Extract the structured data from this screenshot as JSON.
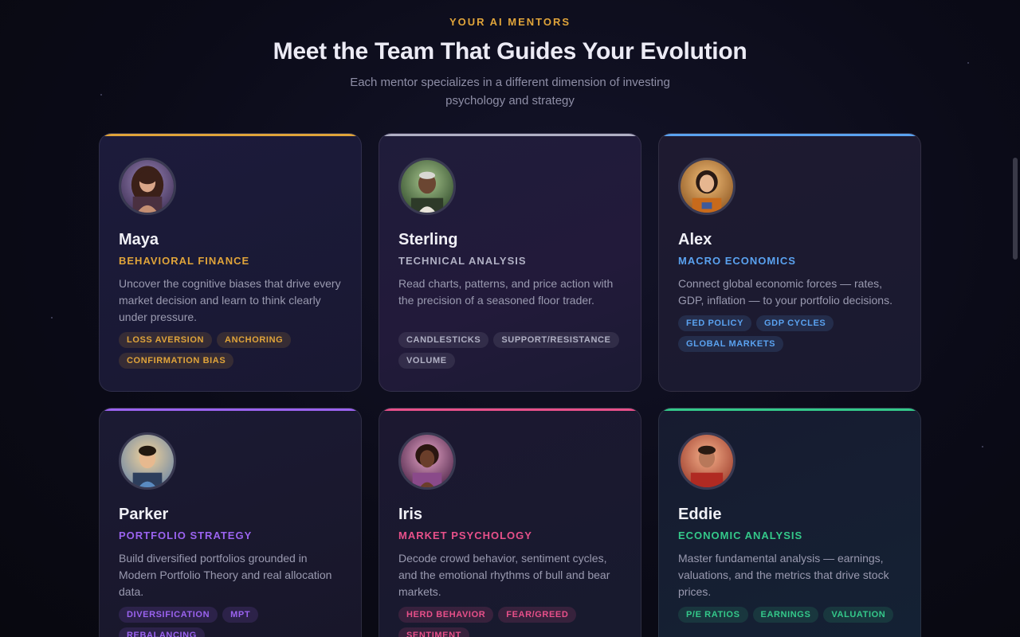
{
  "header": {
    "eyebrow": "YOUR AI MENTORS",
    "title": "Meet the Team That Guides Your Evolution",
    "subtitle": "Each mentor specializes in a different dimension of investing psychology and strategy"
  },
  "mentors": [
    {
      "name": "Maya",
      "role": "BEHAVIORAL FINANCE",
      "accent": "#e0a43a",
      "description": "Uncover the cognitive biases that drive every market decision and learn to think clearly under pressure.",
      "tags": [
        "LOSS AVERSION",
        "ANCHORING",
        "CONFIRMATION BIAS"
      ]
    },
    {
      "name": "Sterling",
      "role": "TECHNICAL ANALYSIS",
      "accent": "#b0b0c4",
      "description": "Read charts, patterns, and price action with the precision of a seasoned floor trader.",
      "tags": [
        "CANDLESTICKS",
        "SUPPORT/RESISTANCE",
        "VOLUME"
      ]
    },
    {
      "name": "Alex",
      "role": "MACRO ECONOMICS",
      "accent": "#5aa2f0",
      "description": "Connect global economic forces — rates, GDP, inflation — to your portfolio decisions.",
      "tags": [
        "FED POLICY",
        "GDP CYCLES",
        "GLOBAL MARKETS"
      ]
    },
    {
      "name": "Parker",
      "role": "PORTFOLIO STRATEGY",
      "accent": "#9b63f0",
      "description": "Build diversified portfolios grounded in Modern Portfolio Theory and real allocation data.",
      "tags": [
        "DIVERSIFICATION",
        "MPT",
        "REBALANCING"
      ]
    },
    {
      "name": "Iris",
      "role": "MARKET PSYCHOLOGY",
      "accent": "#e8508a",
      "description": "Decode crowd behavior, sentiment cycles, and the emotional rhythms of bull and bear markets.",
      "tags": [
        "HERD BEHAVIOR",
        "FEAR/GREED",
        "SENTIMENT"
      ]
    },
    {
      "name": "Eddie",
      "role": "ECONOMIC ANALYSIS",
      "accent": "#34c98a",
      "description": "Master fundamental analysis — earnings, valuations, and the metrics that drive stock prices.",
      "tags": [
        "P/E RATIOS",
        "EARNINGS",
        "VALUATION"
      ]
    }
  ]
}
